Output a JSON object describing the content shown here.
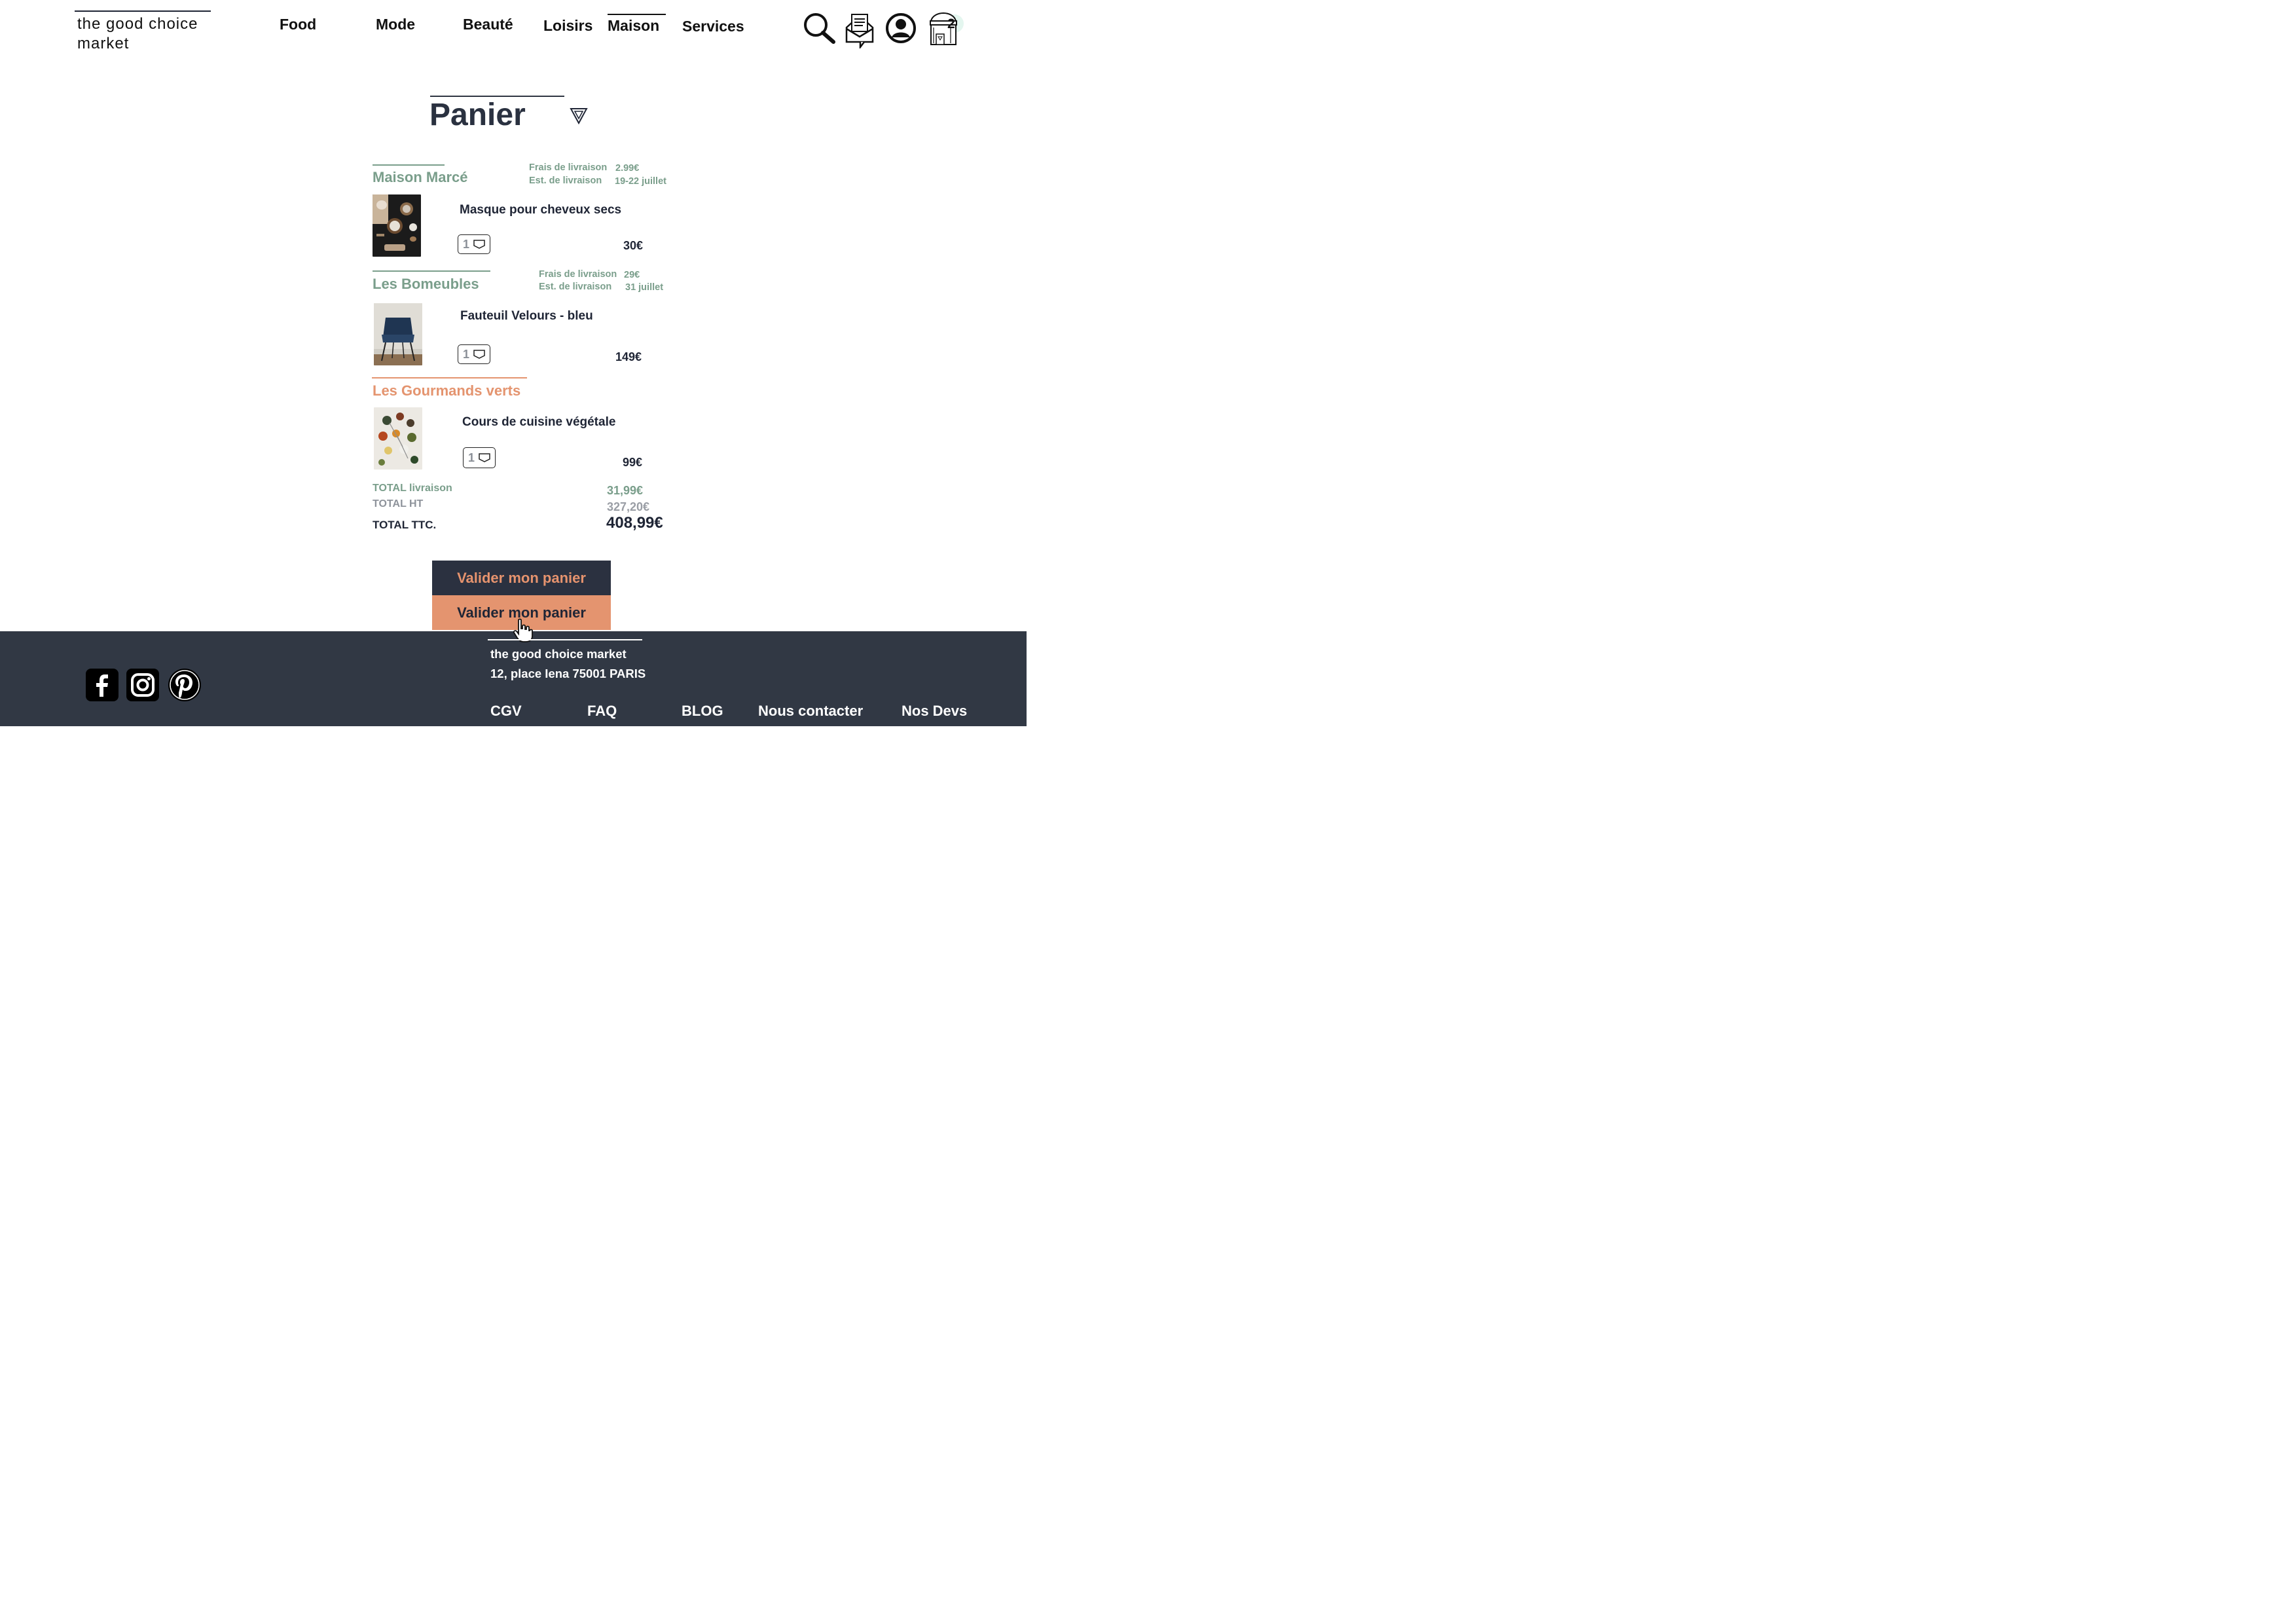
{
  "header": {
    "logo": "the good choice market",
    "nav": [
      "Food",
      "Mode",
      "Beauté",
      "Loisirs",
      "Maison",
      "Services"
    ],
    "active_nav": "Maison",
    "cart_count": "2",
    "icons": [
      "search-icon",
      "message-icon",
      "account-icon",
      "cart-icon"
    ]
  },
  "cart": {
    "title": "Panier",
    "vendors": [
      {
        "name": "Maison Marcé",
        "color": "#7a9e8b",
        "shipping_label": "Frais de livraison",
        "shipping_value": "2.99€",
        "estimate_label": "Est. de livraison",
        "estimate_value": "19-22 juillet",
        "product": {
          "name": "Masque pour cheveux secs",
          "qty": "1",
          "price": "30€"
        }
      },
      {
        "name": "Les Bomeubles",
        "color": "#7a9e8b",
        "shipping_label": "Frais de livraison",
        "shipping_value": "29€",
        "estimate_label": "Est. de livraison",
        "estimate_value": "31 juillet",
        "product": {
          "name": "Fauteuil Velours - bleu",
          "qty": "1",
          "price": "149€"
        }
      },
      {
        "name": "Les Gourmands verts",
        "color": "#e4946f",
        "product": {
          "name": "Cours de cuisine végétale",
          "qty": "1",
          "price": "99€"
        }
      }
    ],
    "totals": {
      "delivery_label": "TOTAL livraison",
      "delivery_value": "31,99€",
      "ht_label": "TOTAL HT",
      "ht_value": "327,20€",
      "ttc_label": "TOTAL TTC.",
      "ttc_value": "408,99€"
    },
    "validate_label": "Valider mon panier",
    "validate_hover_label": "Valider mon panier"
  },
  "footer": {
    "company": "the good choice market",
    "address": "12, place Iena 75001 PARIS",
    "links": [
      "CGV",
      "FAQ",
      "BLOG",
      "Nous contacter",
      "Nos Devs"
    ],
    "social": [
      "facebook-icon",
      "instagram-icon",
      "pinterest-icon"
    ]
  },
  "colors": {
    "dark": "#2b3140",
    "green": "#7a9e8b",
    "orange": "#e4946f",
    "footer_bg": "#313844"
  }
}
